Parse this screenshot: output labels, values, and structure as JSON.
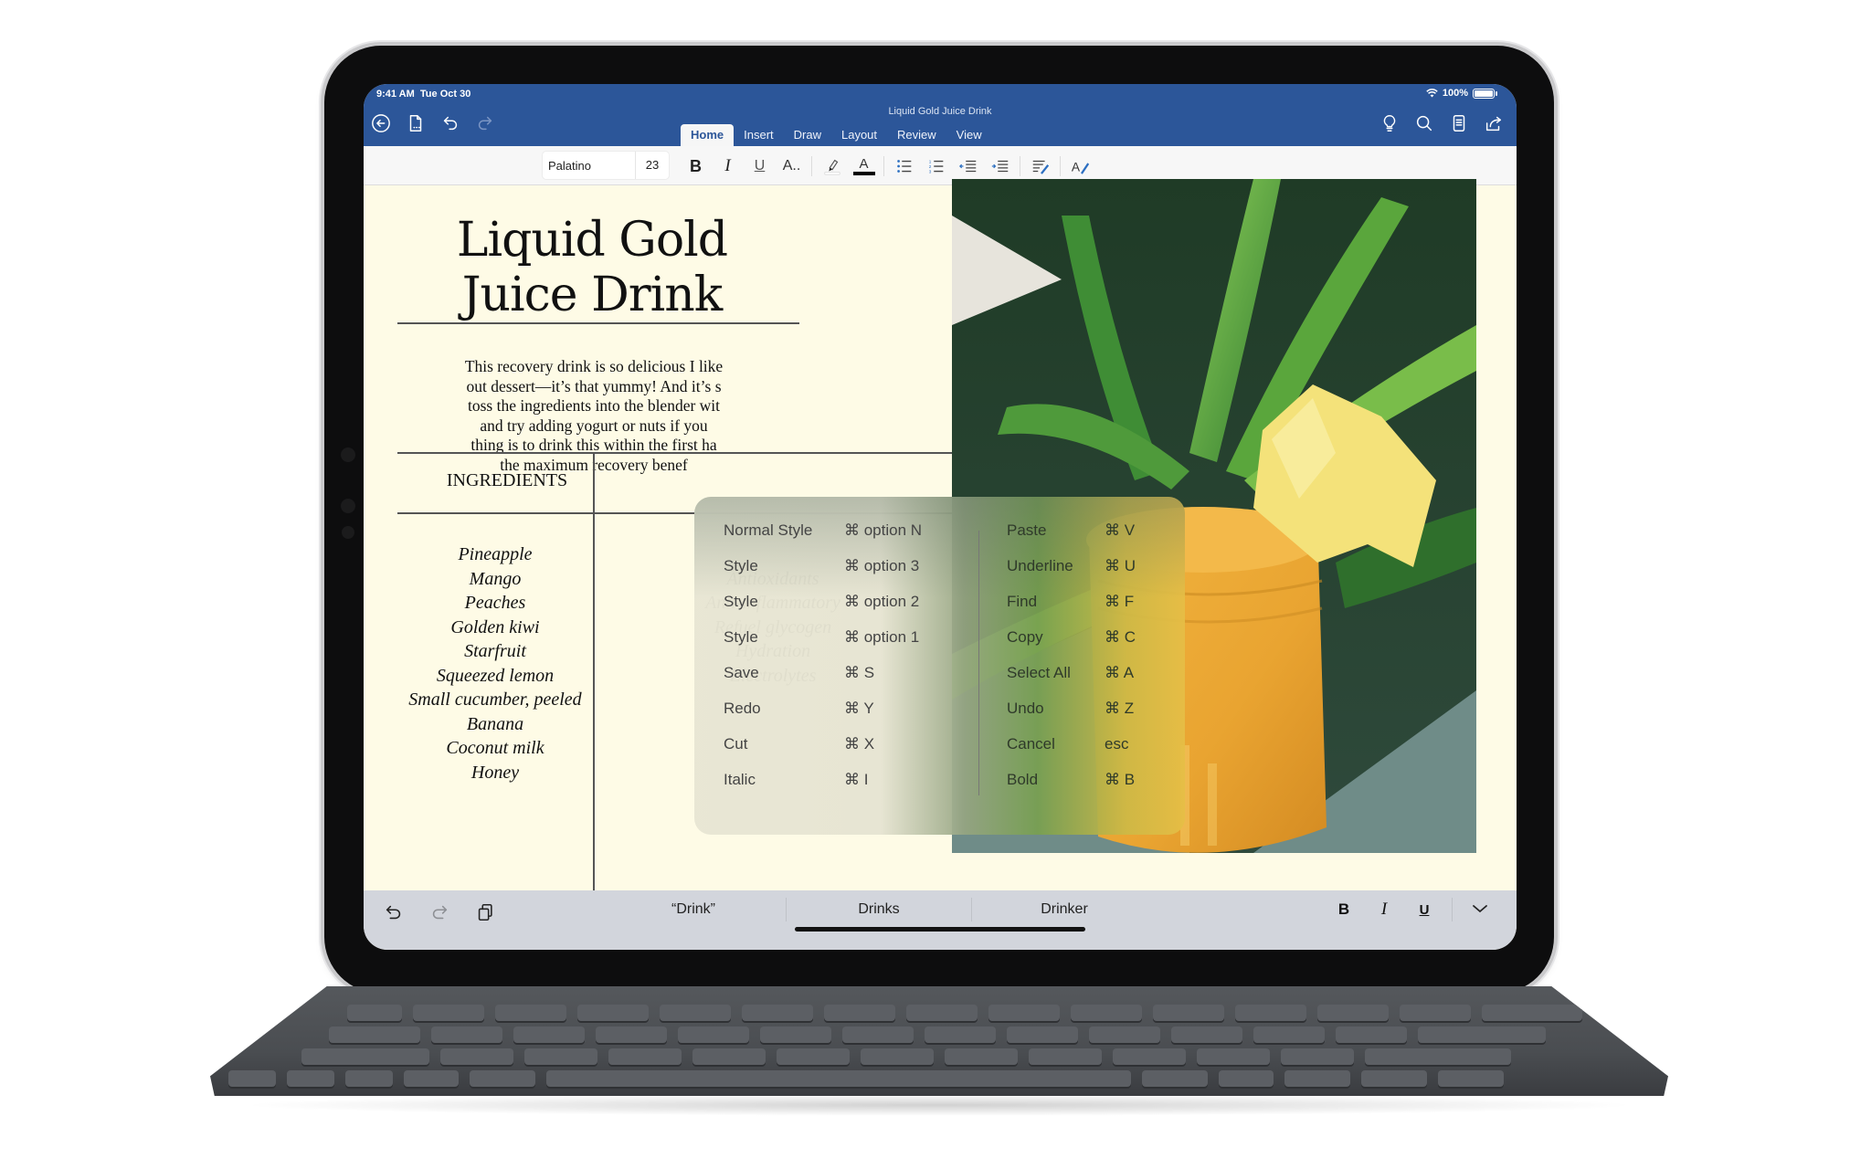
{
  "status_bar": {
    "time": "9:41 AM",
    "date": "Tue Oct 30",
    "battery": "100%"
  },
  "header": {
    "document_title": "Liquid Gold Juice Drink",
    "left_icons": [
      "back-icon",
      "file-icon",
      "undo-icon",
      "redo-icon"
    ],
    "right_icons": [
      "lightbulb-icon",
      "search-icon",
      "mobile-view-icon",
      "share-icon"
    ],
    "tabs": [
      {
        "label": "Home",
        "active": true
      },
      {
        "label": "Insert",
        "active": false
      },
      {
        "label": "Draw",
        "active": false
      },
      {
        "label": "Layout",
        "active": false
      },
      {
        "label": "Review",
        "active": false
      },
      {
        "label": "View",
        "active": false
      }
    ]
  },
  "toolbar": {
    "font_name": "Palatino",
    "font_size": "23",
    "bold": "B",
    "italic": "I",
    "underline": "U",
    "more_font": "A..",
    "font_color_letter": "A",
    "styles_letter": "A"
  },
  "document": {
    "title_line1": "Liquid Gold",
    "title_line2": "Juice Drink",
    "intro_lines": [
      "This recovery drink is so delicious I like",
      "out dessert—it’s that yummy! And it’s s",
      "toss the ingredients into the blender wit",
      "and try adding yogurt or nuts if you",
      "thing is to drink this within the first ha",
      "the maximum recovery benef"
    ],
    "ingredients_heading": "INGREDIENTS",
    "ingredients": [
      "Pineapple",
      "Mango",
      "Peaches",
      "Golden kiwi",
      "Starfruit",
      "Squeezed lemon",
      "Small cucumber, peeled",
      "Banana",
      "Coconut milk",
      "Honey"
    ],
    "benefits": [
      "Antioxidants",
      "Anti-inflammatory",
      "Refuel glycogen",
      "Hydration",
      "Electrolytes"
    ]
  },
  "shortcuts": {
    "left": [
      {
        "name": "Normal Style",
        "key": "⌘ option N"
      },
      {
        "name": "Style",
        "key": "⌘ option 3"
      },
      {
        "name": "Style",
        "key": "⌘ option 2"
      },
      {
        "name": "Style",
        "key": "⌘ option 1"
      },
      {
        "name": "Save",
        "key": "⌘ S"
      },
      {
        "name": "Redo",
        "key": "⌘ Y"
      },
      {
        "name": "Cut",
        "key": "⌘ X"
      },
      {
        "name": "Italic",
        "key": "⌘ I"
      }
    ],
    "right": [
      {
        "name": "Paste",
        "key": "⌘ V"
      },
      {
        "name": "Underline",
        "key": "⌘ U"
      },
      {
        "name": "Find",
        "key": "⌘ F"
      },
      {
        "name": "Copy",
        "key": "⌘ C"
      },
      {
        "name": "Select All",
        "key": "⌘ A"
      },
      {
        "name": "Undo",
        "key": "⌘ Z"
      },
      {
        "name": "Cancel",
        "key": "esc"
      },
      {
        "name": "Bold",
        "key": "⌘ B"
      }
    ]
  },
  "bottom_bar": {
    "suggestions": [
      "“Drink”",
      "Drinks",
      "Drinker"
    ],
    "format": {
      "bold": "B",
      "italic": "I",
      "underline": "U"
    }
  },
  "colors": {
    "header_blue": "#2c5699",
    "page_cream": "#fefbe6",
    "bottom_bar": "#d2d5dc"
  }
}
